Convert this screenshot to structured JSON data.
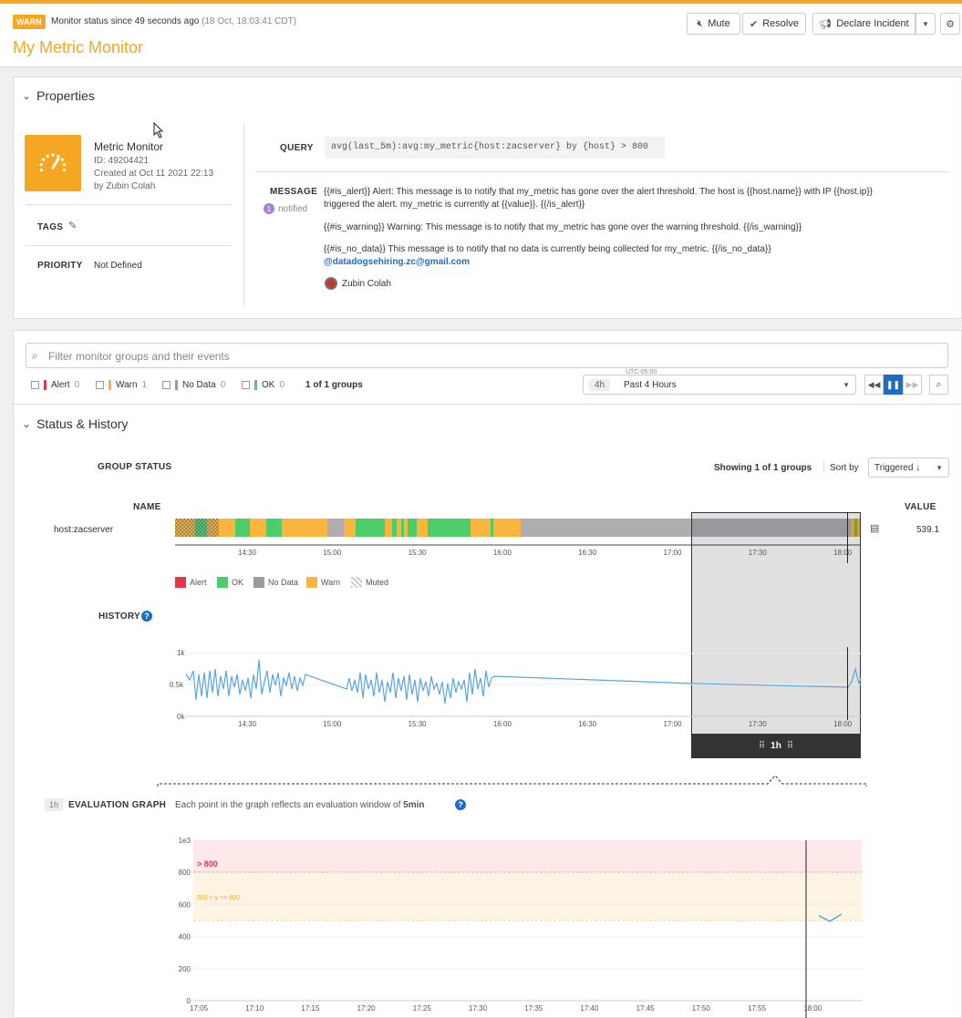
{
  "header": {
    "badge": "WARN",
    "status_text": "Monitor status since 49 seconds ago",
    "status_time": "(18 Oct, 18:03:41 CDT)",
    "title": "My Metric Monitor",
    "mute_label": "Mute",
    "resolve_label": "Resolve",
    "declare_label": "Declare Incident",
    "accent_color": "#f5a623"
  },
  "properties": {
    "section_title": "Properties",
    "monitor_type": "Metric Monitor",
    "id": "ID: 49204421",
    "created": "Created at Oct 11 2021 22:13",
    "author": "by Zubin Colah",
    "tags_label": "TAGS",
    "priority_label": "PRIORITY",
    "priority_value": "Not Defined",
    "query_label": "QUERY",
    "query": "avg(last_5m):avg:my_metric{host:zacserver} by {host} > 800",
    "message_label": "MESSAGE",
    "notified_count": "1",
    "notified_label": "notified",
    "msg_alert": "{{#is_alert}} Alert: This message is to notify that my_metric has gone over the alert threshold. The host is {{host.name}} with IP {{host.ip}}",
    "msg_alert_2": "triggered the alert. my_metric is currently at {{value}}. {{/is_alert}}",
    "msg_warning": "{{#is_warning}} Warning: This message is to notify that my_metric has gone over the warning threshold. {{/is_warning}}",
    "msg_nodata": "{{#is_no_data}} This message is to notify that no data is currently being collected for my_metric. {{/is_no_data}}",
    "msg_email": "@datadogsehiring.zc@gmail.com",
    "notified_user": "Zubin Colah"
  },
  "filters": {
    "search_placeholder": "Filter monitor groups and their events",
    "alert_label": "Alert",
    "alert_count": "0",
    "warn_label": "Warn",
    "warn_count": "1",
    "nodata_label": "No Data",
    "nodata_count": "0",
    "ok_label": "OK",
    "ok_count": "0",
    "groups_text": "1 of 1 groups",
    "timezone": "UTC-05:00",
    "range_short": "4h",
    "range_label": "Past 4 Hours"
  },
  "status_history": {
    "section_title": "Status & History",
    "group_status_label": "GROUP STATUS",
    "showing_text": "Showing 1 of 1 groups",
    "sort_label": "Sort by",
    "sort_value": "Triggered ↓",
    "name_header": "NAME",
    "value_header": "VALUE",
    "group_name": "host:zacserver",
    "group_value": "539.1",
    "time_ticks": [
      "14:30",
      "15:00",
      "15:30",
      "16:00",
      "16:30",
      "17:00",
      "17:30",
      "18:00"
    ],
    "legend": [
      {
        "label": "Alert",
        "color": "#e5374a"
      },
      {
        "label": "OK",
        "color": "#4ccc6a"
      },
      {
        "label": "No Data",
        "color": "#9b9b9b"
      },
      {
        "label": "Warn",
        "color": "#f9b53d"
      },
      {
        "label": "Muted",
        "color": "#cccccc"
      }
    ],
    "history_label": "HISTORY",
    "history_yticks": [
      "1k",
      "0.5k",
      "0k"
    ],
    "window_label": "1h",
    "colors": {
      "ok": "#4ccc6a",
      "warn": "#f9b53d",
      "nodata": "#b0adb2",
      "line": "#5aa6e0"
    }
  },
  "evaluation": {
    "badge": "1h",
    "label": "EVALUATION GRAPH",
    "desc_prefix": "Each point in the graph reflects an evaluation window of",
    "desc_bold": "5min",
    "alert_band_label": "> 800",
    "warn_band_label": "500 < y <= 800",
    "yticks": [
      "1e3",
      "800",
      "600",
      "400",
      "200",
      "0"
    ],
    "xticks": [
      "17:05",
      "17:10",
      "17:15",
      "17:20",
      "17:25",
      "17:30",
      "17:35",
      "17:40",
      "17:45",
      "17:50",
      "17:55",
      "18:00"
    ]
  },
  "chart_data": {
    "type": "line",
    "title": "",
    "xlabel": "",
    "ylabel": "",
    "ylim": [
      0,
      1000
    ],
    "x": [
      "18:01",
      "18:02",
      "18:03"
    ],
    "series": [
      {
        "values": [
          530,
          495,
          540
        ]
      }
    ],
    "thresholds": {
      "alert": 800,
      "warning": 500
    }
  }
}
